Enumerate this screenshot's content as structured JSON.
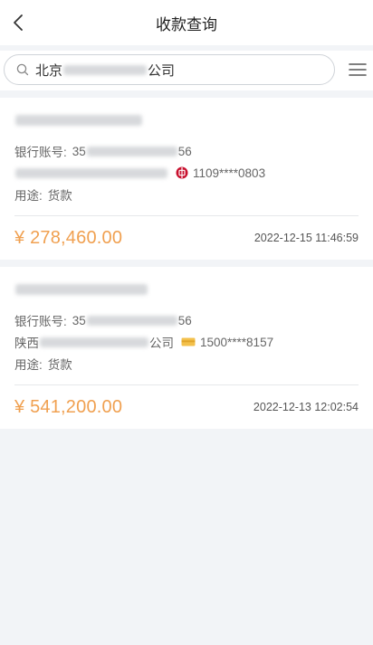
{
  "header": {
    "title": "收款查询"
  },
  "search": {
    "prefix": "北京",
    "suffix": "公司"
  },
  "records": [
    {
      "account_label": "银行账号:",
      "account_prefix": "35",
      "account_suffix": "56",
      "bank_account_masked": "1109****0803",
      "purpose_label": "用途:",
      "purpose": "货款",
      "amount": "¥ 278,460.00",
      "datetime": "2022-12-15 11:46:59",
      "bank_icon": "bank-of-china-logo-icon"
    },
    {
      "account_label": "银行账号:",
      "account_prefix": "35",
      "account_suffix": "56",
      "payer_prefix": "陕西",
      "payer_suffix": "公司",
      "bank_account_masked": "1500****8157",
      "purpose_label": "用途:",
      "purpose": "货款",
      "amount": "¥ 541,200.00",
      "datetime": "2022-12-13 12:02:54",
      "bank_icon": "bank-card-icon"
    }
  ],
  "colors": {
    "amount": "#f0a050",
    "background": "#f2f4f7"
  }
}
